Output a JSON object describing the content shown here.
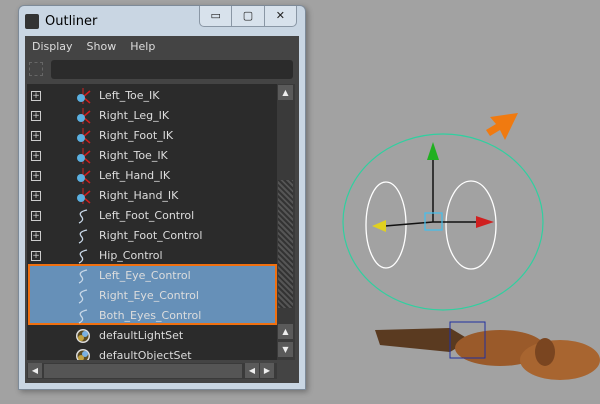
{
  "window": {
    "title": "Outliner",
    "buttons": [
      "▭",
      "▢",
      "✕"
    ]
  },
  "menu": [
    "Display",
    "Show",
    "Help"
  ],
  "filter": {
    "value": ""
  },
  "items": [
    {
      "label": "Left_Toe_IK",
      "icon": "ik-handle-icon",
      "expandable": true
    },
    {
      "label": "Right_Leg_IK",
      "icon": "ik-handle-icon",
      "expandable": true
    },
    {
      "label": "Right_Foot_IK",
      "icon": "ik-handle-icon",
      "expandable": true
    },
    {
      "label": "Right_Toe_IK",
      "icon": "ik-handle-icon",
      "expandable": true
    },
    {
      "label": "Left_Hand_IK",
      "icon": "ik-handle-icon",
      "expandable": true
    },
    {
      "label": "Right_Hand_IK",
      "icon": "ik-handle-icon",
      "expandable": true
    },
    {
      "label": "Left_Foot_Control",
      "icon": "curve-icon",
      "expandable": true
    },
    {
      "label": "Right_Foot_Control",
      "icon": "curve-icon",
      "expandable": true
    },
    {
      "label": "Hip_Control",
      "icon": "curve-icon",
      "expandable": true
    },
    {
      "label": "Left_Eye_Control",
      "icon": "curve-icon",
      "expandable": false,
      "selected": true
    },
    {
      "label": "Right_Eye_Control",
      "icon": "curve-icon",
      "expandable": false,
      "selected": true
    },
    {
      "label": "Both_Eyes_Control",
      "icon": "curve-icon",
      "expandable": false,
      "selected": true
    },
    {
      "label": "defaultLightSet",
      "icon": "set-icon",
      "expandable": false
    },
    {
      "label": "defaultObjectSet",
      "icon": "set-icon",
      "expandable": false
    }
  ],
  "colors": {
    "highlight": "#f07010",
    "selection": "#6690b8",
    "control_curve": "#30d0a0"
  }
}
